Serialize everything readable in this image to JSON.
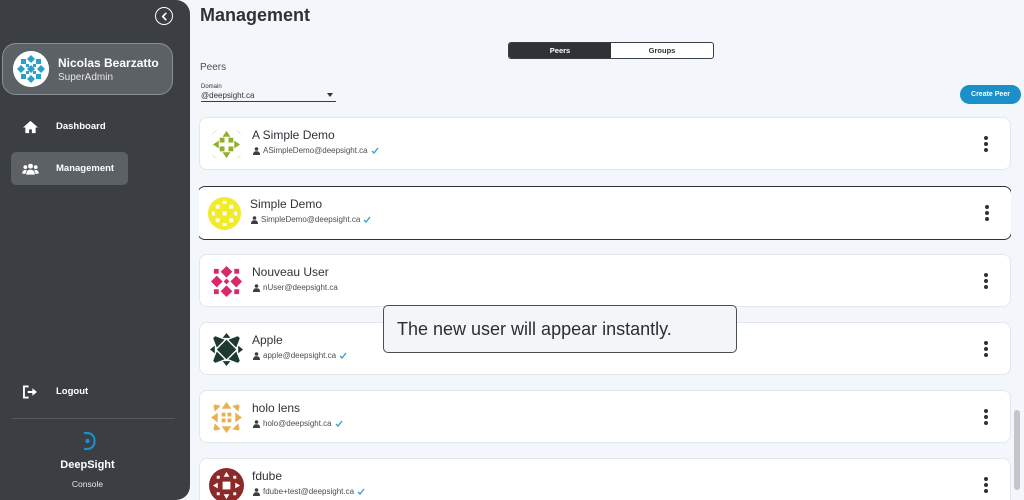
{
  "sidebar": {
    "user": {
      "name": "Nicolas Bearzatto",
      "role": "SuperAdmin"
    },
    "nav": [
      {
        "label": "Dashboard",
        "icon": "home-icon",
        "active": false
      },
      {
        "label": "Management",
        "icon": "users-icon",
        "active": true
      }
    ],
    "logout_label": "Logout",
    "brand": {
      "name": "DeepSight",
      "sub": "Console"
    }
  },
  "header": {
    "title": "Management"
  },
  "tabs": [
    {
      "label": "Peers",
      "active": true
    },
    {
      "label": "Groups",
      "active": false
    }
  ],
  "section_label": "Peers",
  "domain": {
    "label": "Domain",
    "value": "@deepsight.ca"
  },
  "create_button": "Create Peer",
  "peers": [
    {
      "name": "A Simple Demo",
      "email": "ASimpleDemo@deepsight.ca",
      "verified": true,
      "color": "#8fb02a"
    },
    {
      "name": "Simple Demo",
      "email": "SimpleDemo@deepsight.ca",
      "verified": true,
      "color": "#f2ea2c"
    },
    {
      "name": "Nouveau User",
      "email": "nUser@deepsight.ca",
      "verified": false,
      "color": "#d62a6b"
    },
    {
      "name": "Apple",
      "email": "apple@deepsight.ca",
      "verified": true,
      "color": "#1e3a2e"
    },
    {
      "name": "holo lens",
      "email": "holo@deepsight.ca",
      "verified": true,
      "color": "#e8b050"
    },
    {
      "name": "fdube",
      "email": "fdube+test@deepsight.ca",
      "verified": true,
      "color": "#8c2a2a"
    }
  ],
  "tooltip": "The new user will appear instantly.",
  "colors": {
    "sidebar": "#3b3f44",
    "accent": "#1a8fc8",
    "background": "#f3f7fb",
    "verified": "#3a9fd6"
  }
}
